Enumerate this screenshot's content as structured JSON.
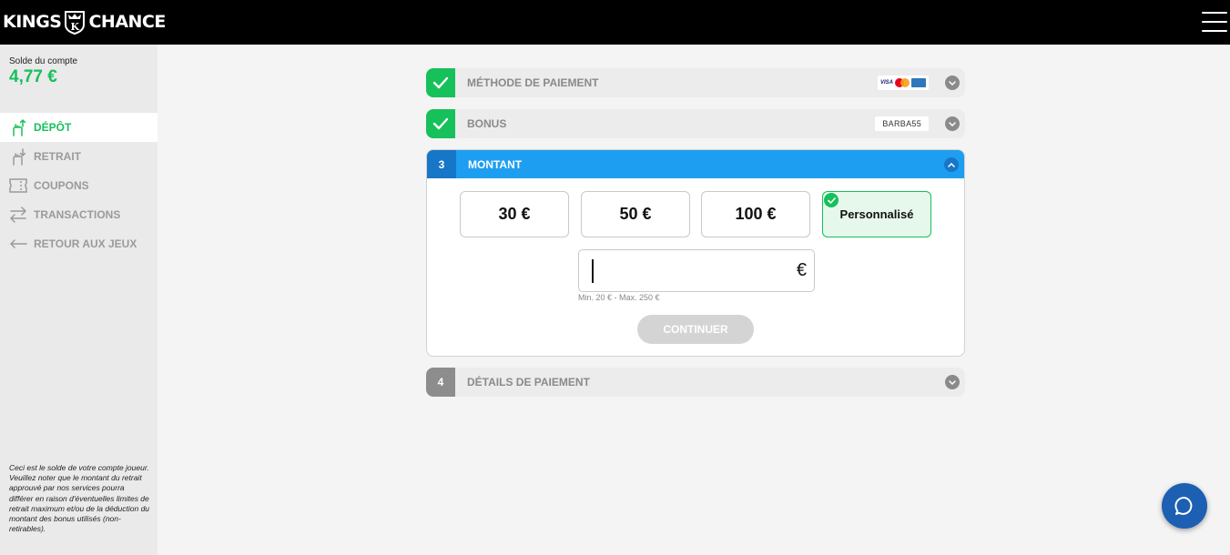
{
  "brand": {
    "left": "KINGS",
    "right": "CHANCE",
    "crest_letter": "K"
  },
  "sidebar": {
    "balance_label": "Solde du compte",
    "balance_value": "4,77 €",
    "items": [
      {
        "label": "Dépôt",
        "icon": "deposit-hand-icon",
        "active": true
      },
      {
        "label": "Retrait",
        "icon": "withdraw-hand-icon",
        "active": false
      },
      {
        "label": "Coupons",
        "icon": "coupon-icon",
        "active": false
      },
      {
        "label": "Transactions",
        "icon": "transactions-arrows-icon",
        "active": false
      },
      {
        "label": "Retour aux jeux",
        "icon": "back-arrow-icon",
        "active": false
      }
    ],
    "disclaimer": "Ceci est le solde de votre compte joueur. Veuillez noter que le montant du retrait approuvé par nos services pourra différer en raison d'éventuelles limites de retrait maximum et/ou de la déduction du montant des bonus utilisés (non-retirables)."
  },
  "steps": {
    "payment": {
      "title": "Méthode de paiement",
      "visa": "VISA"
    },
    "bonus": {
      "title": "Bonus",
      "code": "BARBA55"
    },
    "amount": {
      "number": "3",
      "title": "Montant",
      "options": [
        "30 €",
        "50 €",
        "100 €",
        "Personnalisé"
      ],
      "selected": "Personnalisé",
      "input_value": "",
      "currency": "€",
      "limits": "Min. 20 € - Max. 250 €",
      "continue": "CONTINUER"
    },
    "details": {
      "number": "4",
      "title": "Détails de paiement"
    }
  },
  "colors": {
    "accent_green": "#16c05a",
    "header_blue": "#1e9ef0",
    "badge_blue": "#1676c8",
    "chat_blue": "#1c5fb3",
    "topbar": "#000000"
  }
}
